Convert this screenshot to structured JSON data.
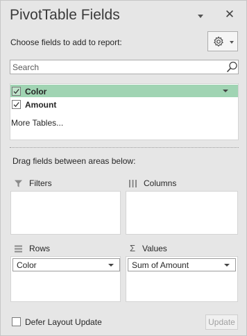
{
  "pane": {
    "title": "PivotTable Fields",
    "close_glyph": "✕",
    "choose_label": "Choose fields to add to report:",
    "tools_icon": "gear-icon"
  },
  "search": {
    "placeholder": "Search",
    "value": ""
  },
  "fields": [
    {
      "name": "Color",
      "checked": true,
      "selected": true
    },
    {
      "name": "Amount",
      "checked": true,
      "selected": false
    }
  ],
  "more_tables": "More Tables...",
  "drag_label": "Drag fields between areas below:",
  "areas": {
    "filters": {
      "label": "Filters",
      "icon": "filter-icon",
      "items": []
    },
    "columns": {
      "label": "Columns",
      "icon": "columns-icon",
      "items": []
    },
    "rows": {
      "label": "Rows",
      "icon": "rows-icon",
      "items": [
        "Color"
      ]
    },
    "values": {
      "label": "Values",
      "icon": "sigma-icon",
      "items": [
        "Sum of Amount"
      ]
    }
  },
  "footer": {
    "defer_label": "Defer Layout Update",
    "defer_checked": false,
    "update_label": "Update",
    "update_enabled": false
  },
  "colors": {
    "selected_row": "#a0d4b3",
    "pane_background": "#e6e6e6"
  }
}
